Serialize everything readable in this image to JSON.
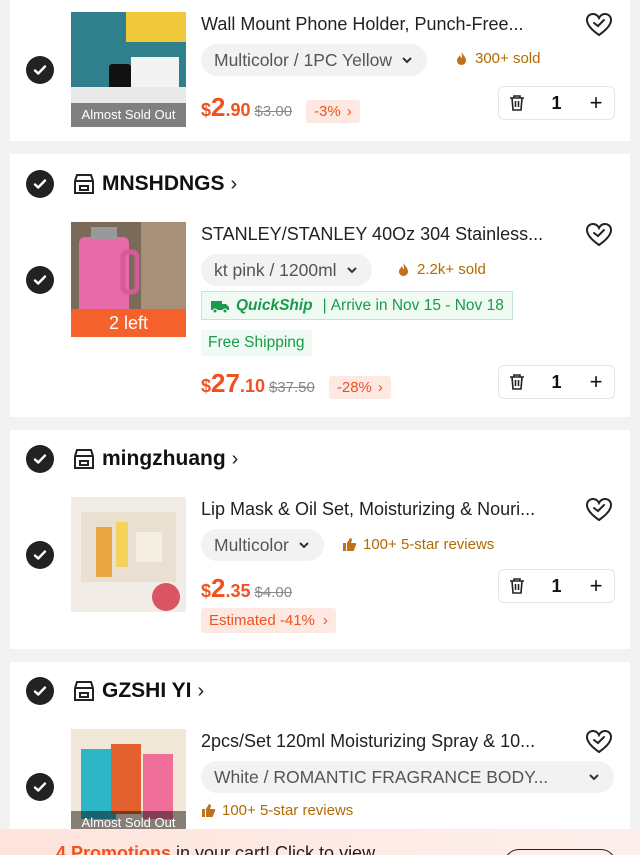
{
  "items": [
    {
      "store": null,
      "title": "Wall Mount Phone Holder, Punch-Free...",
      "variant": "Multicolor / 1PC Yellow",
      "social_text": "300+ sold",
      "social_icon": "flame-icon",
      "thumb_tag": "Almost Sold Out",
      "price_currency": "$",
      "price_int": "2",
      "price_dec": ".90",
      "price_original": "$3.00",
      "discount": "-3%",
      "quantity": "1"
    },
    {
      "store": "MNSHDNGS",
      "title": "STANLEY/STANLEY 40Oz  304 Stainless...",
      "variant": "kt pink / 1200ml",
      "social_text": "2.2k+ sold",
      "social_icon": "flame-icon",
      "thumb_tag": "2 left",
      "quickship_label": "QuickShip",
      "quickship_arrive": "Arrive in Nov 15 - Nov 18",
      "free_shipping": "Free Shipping",
      "price_currency": "$",
      "price_int": "27",
      "price_dec": ".10",
      "price_original": "$37.50",
      "discount": "-28%",
      "quantity": "1"
    },
    {
      "store": "mingzhuang",
      "title": "Lip Mask & Oil Set, Moisturizing & Nouri...",
      "variant": "Multicolor",
      "social_text": "100+ 5-star reviews",
      "social_icon": "thumbs-up-icon",
      "price_currency": "$",
      "price_int": "2",
      "price_dec": ".35",
      "price_original": "$4.00",
      "estimated": "Estimated -41%",
      "quantity": "1"
    },
    {
      "store": "GZSHI YI",
      "title": "2pcs/Set 120ml Moisturizing Spray & 10...",
      "variant": "White / ROMANTIC FRAGRANCE BODY...",
      "social_text": "100+ 5-star reviews",
      "social_icon": "thumbs-up-icon",
      "thumb_tag": "Almost Sold Out"
    }
  ],
  "promo": {
    "count": "4 Promotions",
    "text": " in your cart! Click to view"
  },
  "colors": {
    "accent": "#f0521f",
    "green": "#1a9a4a",
    "sold": "#b26a00"
  }
}
